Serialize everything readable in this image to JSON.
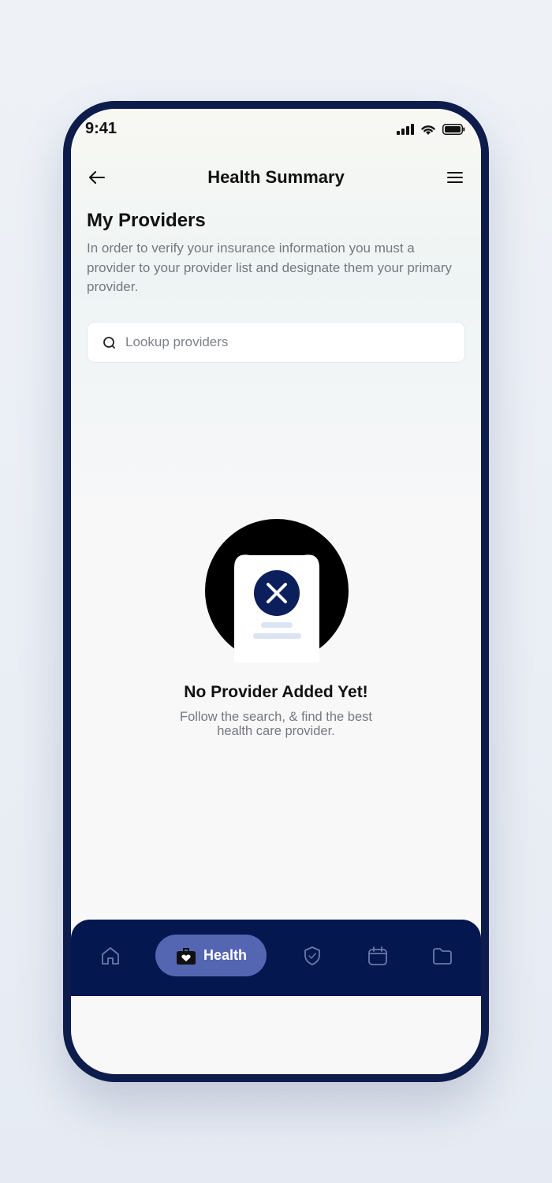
{
  "status_bar": {
    "time": "9:41"
  },
  "header": {
    "title": "Health Summary"
  },
  "providers_section": {
    "title": "My Providers",
    "description": "In order to verify your insurance information you must a provider to your provider list and designate them your primary provider."
  },
  "search": {
    "placeholder": "Lookup providers"
  },
  "empty_state": {
    "title": "No Provider Added Yet!",
    "line1": "Follow the search, & find the best",
    "line2": "health care provider."
  },
  "bottom_nav": {
    "active_label": "Health",
    "items": [
      "home-icon",
      "health-bag-icon",
      "shield-icon",
      "calendar-icon",
      "folder-icon"
    ]
  },
  "colors": {
    "nav_background": "#05174f",
    "nav_pill": "#5466b1",
    "phone_frame": "#0d1c4b",
    "accent_badge": "#0b1f5c"
  }
}
